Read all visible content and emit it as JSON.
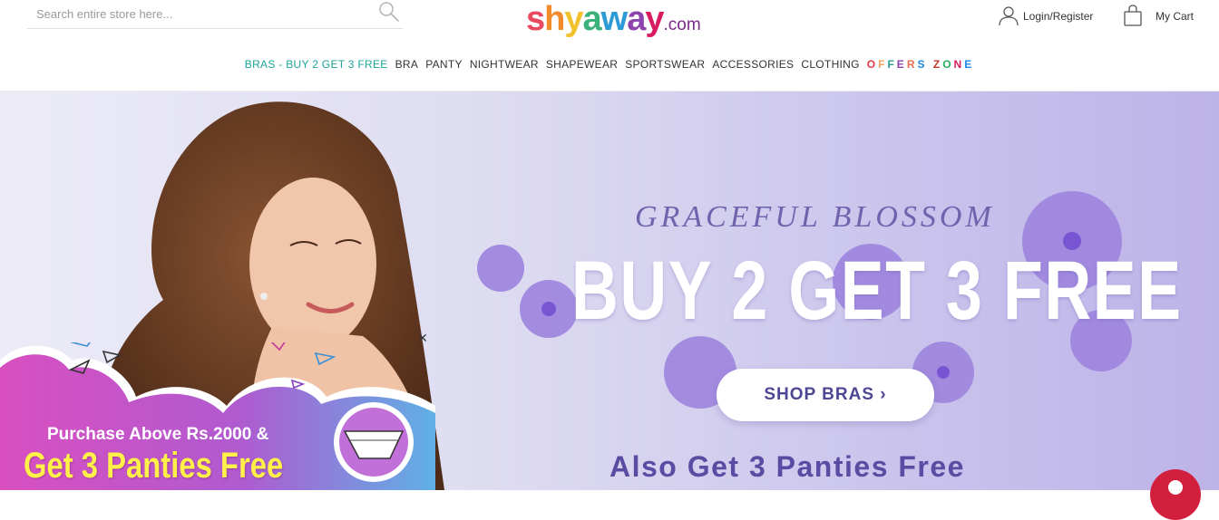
{
  "header": {
    "search": {
      "placeholder": "Search entire store here..."
    },
    "logo": {
      "main": "shyaway",
      "suffix": ".com"
    },
    "account": {
      "login_label": "Login/Register",
      "cart_label": "My Cart"
    }
  },
  "nav": {
    "items": [
      {
        "label": "BRAS - BUY 2 GET 3 FREE"
      },
      {
        "label": "BRA"
      },
      {
        "label": "PANTY"
      },
      {
        "label": "NIGHTWEAR"
      },
      {
        "label": "SHAPEWEAR"
      },
      {
        "label": "SPORTSWEAR"
      },
      {
        "label": "ACCESSORIES"
      },
      {
        "label": "CLOTHING"
      }
    ],
    "offers_zone": {
      "letters": [
        "O",
        "F",
        "F",
        "E",
        "R",
        "S",
        " ",
        "Z",
        "O",
        "N",
        "E"
      ],
      "colors": [
        "#e63946",
        "#f4a261",
        "#2a9d8f",
        "#8e44ad",
        "#e76f51",
        "#1e88e5",
        " ",
        "#c0392b",
        "#27ae60",
        "#d81b60",
        "#1e88e5"
      ]
    }
  },
  "banner": {
    "tagline": "GRACEFUL BLOSSOM",
    "headline": "BUY 2 GET 3 FREE",
    "cta_label": "SHOP BRAS ›",
    "subline": "Also Get 3 Panties Free"
  },
  "popup": {
    "line1": "Purchase Above Rs.2000 &",
    "line2": "Get 3 Panties Free",
    "close_glyph": "×"
  },
  "colors": {
    "brand_teal": "#1ea59b",
    "banner_purple": "#5a4ca3",
    "popup_yellow": "#fff04a",
    "chat_red": "#d31f3e"
  },
  "icons": [
    "search-icon",
    "user-icon",
    "cart-bag-icon",
    "close-icon",
    "chat-icon"
  ]
}
